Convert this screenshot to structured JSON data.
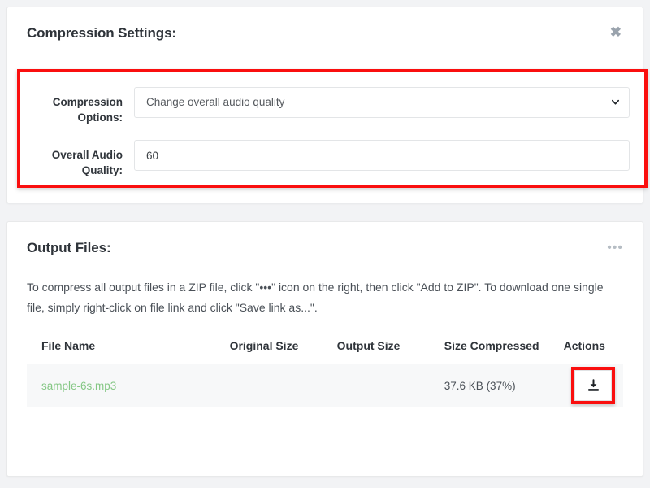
{
  "settings_card": {
    "title": "Compression Settings:",
    "close_icon": "close-icon",
    "close_glyph": "✖",
    "fields": [
      {
        "label": "Compression Options:",
        "type": "select",
        "value": "Change overall audio quality",
        "options": [
          "Change overall audio quality"
        ]
      },
      {
        "label": "Overall Audio Quality:",
        "type": "text",
        "value": "60",
        "placeholder": ""
      }
    ],
    "highlight_color": "#fa0f0f"
  },
  "output_card": {
    "title": "Output Files:",
    "menu_icon": "ellipsis-icon",
    "menu_glyph": "•••",
    "description": "To compress all output files in a ZIP file, click \"•••\" icon on the right, then click \"Add to ZIP\". To download one single file, simply right-click on file link and click \"Save link as...\".",
    "table": {
      "headers": [
        "File Name",
        "Original Size",
        "Output Size",
        "Size Compressed",
        "Actions"
      ],
      "rows": [
        {
          "file_name": "sample-6s.mp3",
          "original_size": "",
          "output_size": "",
          "size_compressed": "37.6 KB (37%)",
          "action_icon": "download-icon"
        }
      ]
    },
    "highlight_color": "#fa0f0f"
  }
}
